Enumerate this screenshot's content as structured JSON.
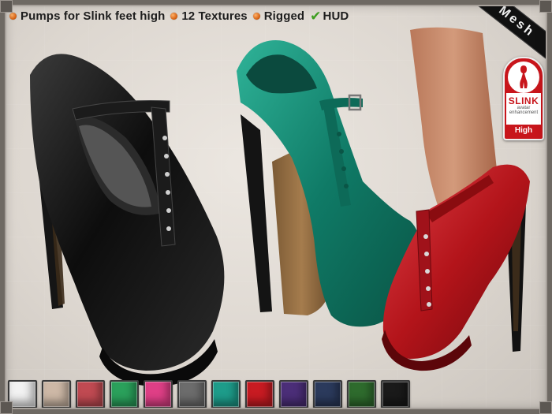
{
  "header": {
    "features": [
      {
        "label": "Pumps for Slink feet high",
        "marker": "orange-bullet"
      },
      {
        "label": "12 Textures",
        "marker": "orange-bullet"
      },
      {
        "label": "Rigged",
        "marker": "orange-bullet"
      },
      {
        "label": "HUD",
        "marker": "green-check"
      }
    ]
  },
  "banner": {
    "text": "Mesh"
  },
  "logo": {
    "brand": "SLINK",
    "tagline_1": "avatar",
    "tagline_2": "enhancement",
    "variant": "High"
  },
  "products": [
    {
      "name": "black-pump",
      "color": "#121212"
    },
    {
      "name": "teal-pump",
      "color": "#0f7a66"
    },
    {
      "name": "red-pump",
      "color": "#b3141a"
    }
  ],
  "swatches": {
    "colors": [
      "#f2f2f2",
      "#cdb8a6",
      "#c04a52",
      "#2aa05b",
      "#df3f86",
      "#6c6c6c",
      "#1d9c8a",
      "#c81b22",
      "#4b2e78",
      "#2b3a5c",
      "#2e6b2d",
      "#1a1a1a"
    ]
  }
}
